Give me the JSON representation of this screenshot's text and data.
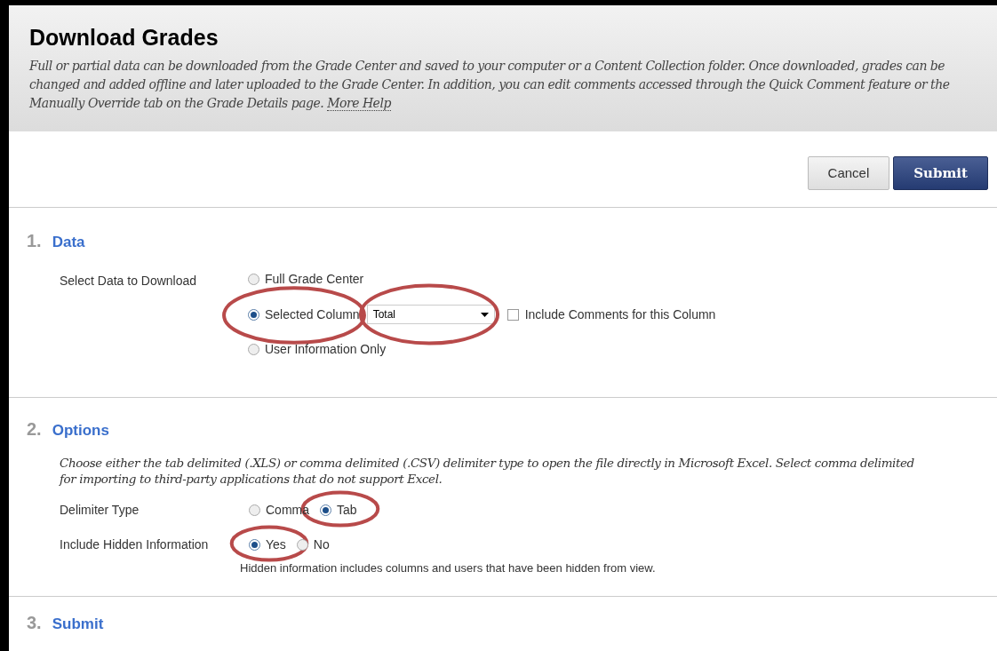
{
  "header": {
    "title": "Download Grades",
    "description": "Full or partial data can be downloaded from the Grade Center and saved to your computer or a Content Collection folder. Once downloaded, grades can be changed and added offline and later uploaded to the Grade Center. In addition, you can edit comments accessed through the Quick Comment feature or the Manually Override tab on the Grade Details page.",
    "help_link": "More Help"
  },
  "buttons": [
    {
      "label": "Cancel",
      "kind": "secondary"
    },
    {
      "label": "Submit",
      "kind": "primary"
    }
  ],
  "sections": [
    {
      "number": "1.",
      "title": "Data",
      "kind": "data",
      "label": "Select Data to Download",
      "options": [
        {
          "label": "Full Grade Center",
          "selected": false,
          "highlighted": false
        },
        {
          "label": "Selected Column",
          "selected": true,
          "highlighted": true,
          "dropdown": {
            "value": "Total",
            "highlighted": true
          },
          "checkbox": {
            "label": "Include Comments for this Column",
            "checked": false
          }
        },
        {
          "label": "User Information Only",
          "selected": false,
          "highlighted": false
        }
      ]
    },
    {
      "number": "2.",
      "title": "Options",
      "kind": "options",
      "instructions": "Choose either the tab delimited (.XLS) or comma delimited (.CSV) delimiter type to open the file directly in Microsoft Excel. Select comma delimited for importing to third-party applications that do not support Excel.",
      "fields": [
        {
          "label": "Delimiter Type",
          "options": [
            {
              "label": "Comma",
              "selected": false,
              "highlighted": false
            },
            {
              "label": "Tab",
              "selected": true,
              "highlighted": true
            }
          ]
        },
        {
          "label": "Include Hidden Information",
          "options": [
            {
              "label": "Yes",
              "selected": true,
              "highlighted": true
            },
            {
              "label": "No",
              "selected": false,
              "highlighted": false
            }
          ],
          "note": "Hidden information includes columns and users that have been hidden from view."
        }
      ]
    },
    {
      "number": "3.",
      "title": "Submit",
      "kind": "submit"
    }
  ]
}
